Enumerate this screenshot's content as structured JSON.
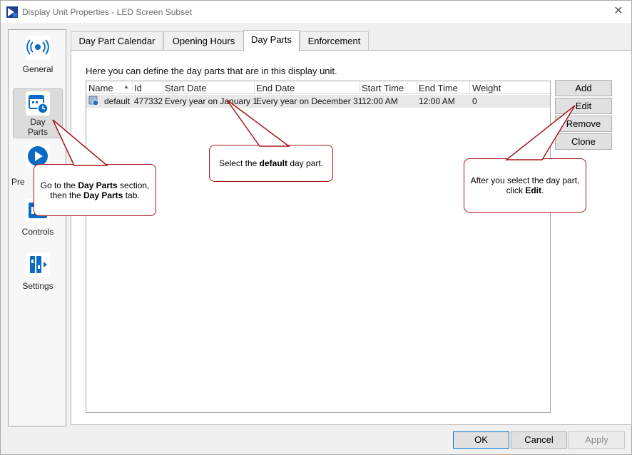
{
  "window": {
    "title": "Display Unit Properties - LED Screen Subset"
  },
  "nav": {
    "items": [
      {
        "label": "General"
      },
      {
        "label": "Day Parts"
      },
      {
        "label": "Pre"
      },
      {
        "label": "Controls"
      },
      {
        "label": "Settings"
      }
    ]
  },
  "tabs": [
    {
      "label": "Day Part Calendar"
    },
    {
      "label": "Opening Hours"
    },
    {
      "label": "Day Parts"
    },
    {
      "label": "Enforcement"
    }
  ],
  "panel": {
    "description": "Here you can define the day parts that are in this display unit.",
    "columns": [
      "Name",
      "Id",
      "Start Date",
      "End Date",
      "Start Time",
      "End Time",
      "Weight"
    ],
    "rows": [
      {
        "name": "default",
        "id": "477332",
        "start_date": "Every year on January 1",
        "end_date": "Every year on December 31",
        "start_time": "12:00 AM",
        "end_time": "12:00 AM",
        "weight": "0"
      }
    ]
  },
  "side_buttons": {
    "add": "Add",
    "edit": "Edit",
    "remove": "Remove",
    "clone": "Clone"
  },
  "footer": {
    "ok": "OK",
    "cancel": "Cancel",
    "apply": "Apply"
  },
  "callouts": {
    "nav": {
      "pre": "Go to the ",
      "b1": "Day Parts",
      "mid": " section, then the ",
      "b2": "Day Parts",
      "post": " tab."
    },
    "select": {
      "pre": "Select the ",
      "b1": "default",
      "post": " day part."
    },
    "edit": {
      "pre": "After you select the day part, click ",
      "b1": "Edit",
      "post": "."
    }
  },
  "colors": {
    "accent": "#0a6bc4",
    "callout_border": "#a8151b",
    "selected_row": "#e8e8e8"
  }
}
